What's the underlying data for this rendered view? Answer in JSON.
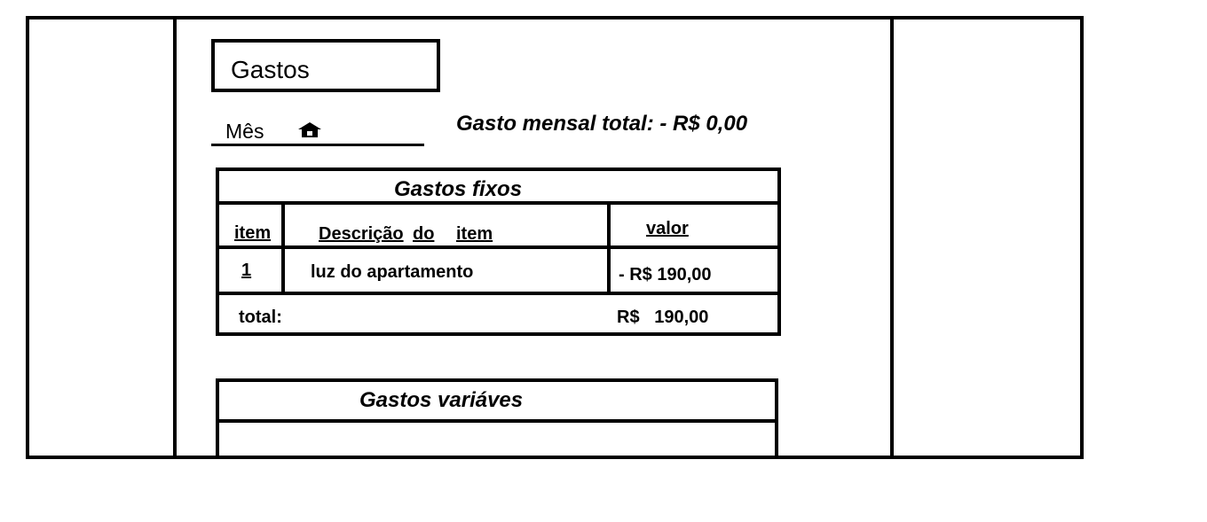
{
  "page": {
    "title": "Gastos",
    "month_label": "Mês",
    "monthly_total": "Gasto mensal total: - R$ 0,00"
  },
  "fixed_expenses": {
    "title": "Gastos fixos",
    "columns": {
      "item": "item",
      "desc_1": "Descrição",
      "desc_2": "do",
      "desc_3": "item",
      "value": "valor"
    },
    "rows": [
      {
        "item": "1",
        "description": "luz do apartamento",
        "value": "- R$ 190,00"
      }
    ],
    "total_label": "total:",
    "total_value": "R$   190,00"
  },
  "variable_expenses": {
    "title": "Gastos variáves"
  },
  "icons": {
    "month_selector": "house-up-arrow-icon"
  }
}
